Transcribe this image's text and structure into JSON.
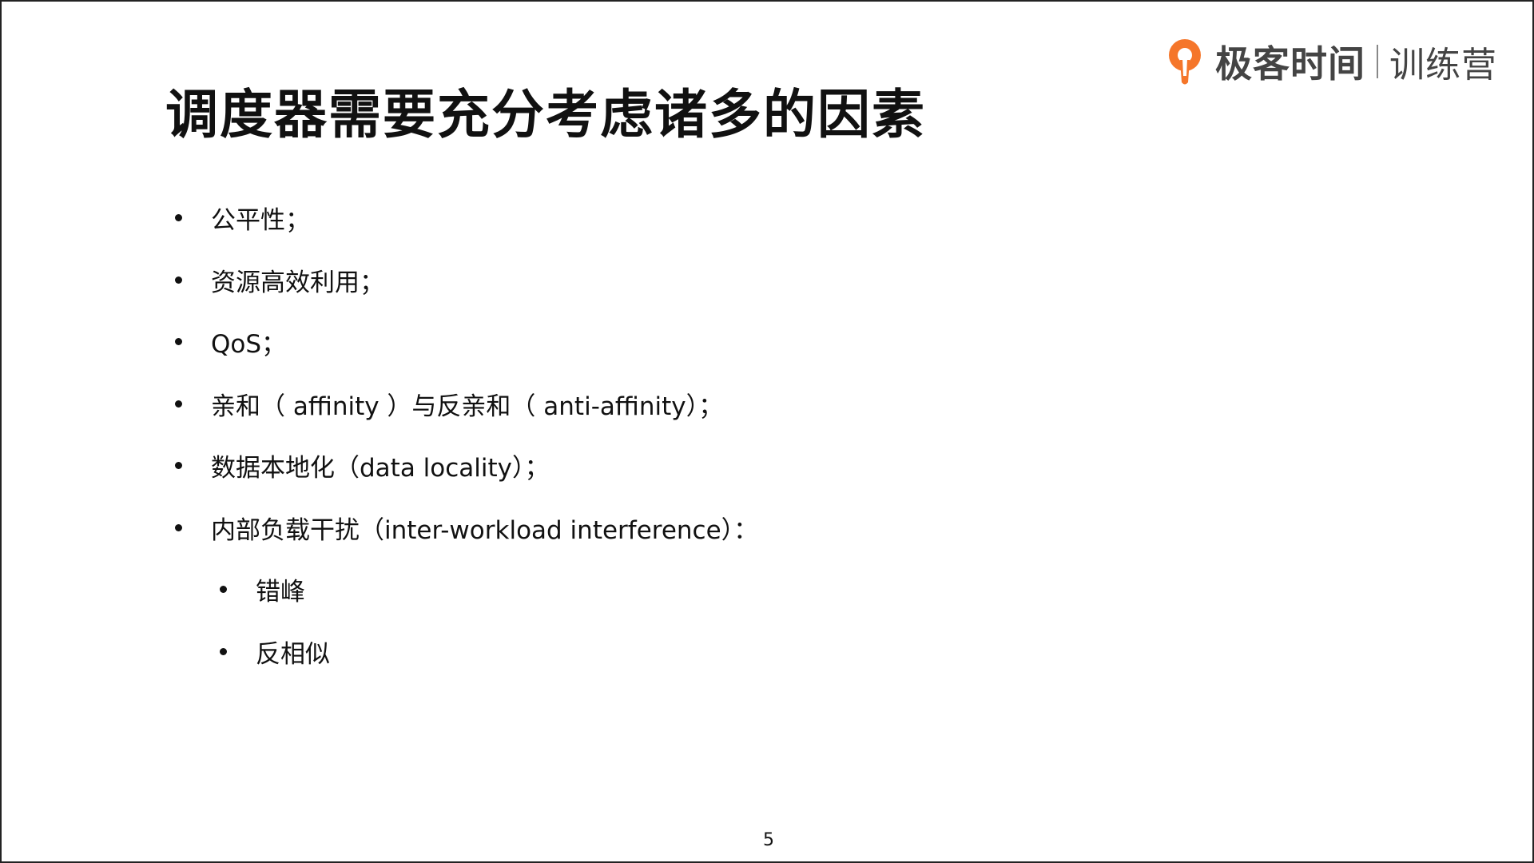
{
  "slide": {
    "title": "调度器需要充分考虑诸多的因素",
    "logo": {
      "brand": "极客时间",
      "sub": "训练营",
      "accent_color": "#F5762A"
    },
    "bullets": [
      {
        "level": 1,
        "text": "公平性；"
      },
      {
        "level": 1,
        "text": "资源高效利用；"
      },
      {
        "level": 1,
        "text": "QoS；"
      },
      {
        "level": 1,
        "text": "亲和（ affinity ）与反亲和（ anti-affinity）；"
      },
      {
        "level": 1,
        "text": "数据本地化（data locality）；"
      },
      {
        "level": 1,
        "text": "内部负载干扰（inter-workload interference）："
      },
      {
        "level": 2,
        "text": "错峰"
      },
      {
        "level": 2,
        "text": "反相似"
      }
    ],
    "page_number": "5"
  }
}
